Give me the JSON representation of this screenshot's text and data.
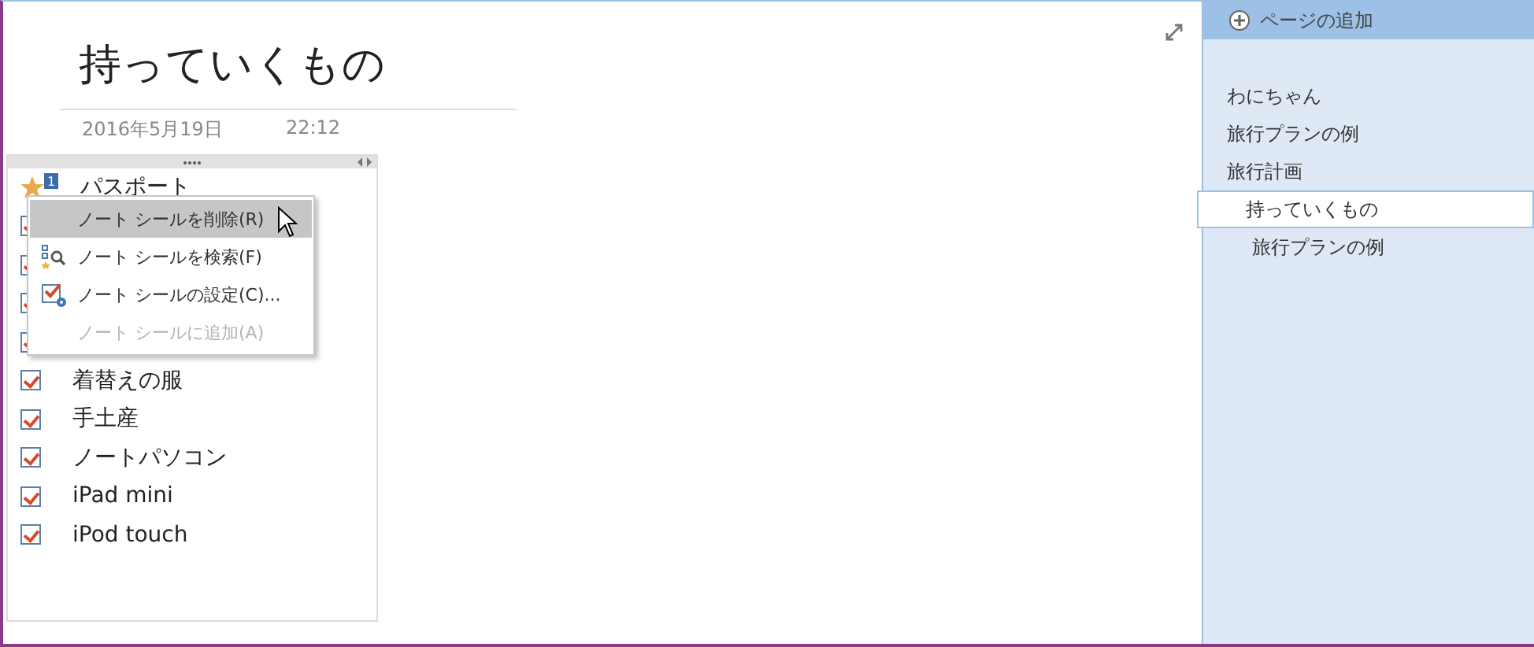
{
  "page": {
    "title": "持っていくもの",
    "date": "2016年5月19日",
    "time": "22:12"
  },
  "items": [
    {
      "kind": "tag",
      "tag_number": "1",
      "label": "パスポート"
    },
    {
      "kind": "checkbox",
      "checked": true
    },
    {
      "kind": "checkbox",
      "checked": true
    },
    {
      "kind": "checkbox",
      "checked": true
    },
    {
      "kind": "checkbox",
      "checked": true
    },
    {
      "kind": "checkbox",
      "checked": true,
      "label": "着替えの服"
    },
    {
      "kind": "checkbox",
      "checked": true,
      "label": "手土産"
    },
    {
      "kind": "checkbox",
      "checked": true,
      "label": "ノートパソコン"
    },
    {
      "kind": "checkbox",
      "checked": true,
      "label": "iPad mini"
    },
    {
      "kind": "checkbox",
      "checked": true,
      "label": "iPod touch"
    }
  ],
  "context_menu": [
    {
      "label": "ノート シールを削除(R)",
      "selected": true,
      "disabled": false
    },
    {
      "label": "ノート シールを検索(F)",
      "selected": false,
      "disabled": false
    },
    {
      "label": "ノート シールの設定(C)...",
      "selected": false,
      "disabled": false
    },
    {
      "label": "ノート シールに追加(A)",
      "selected": false,
      "disabled": true
    }
  ],
  "sidebar": {
    "add_page": "ページの追加",
    "pages": [
      {
        "label": "わにちゃん",
        "selected": false
      },
      {
        "label": "旅行プランの例",
        "selected": false
      },
      {
        "label": "旅行計画",
        "selected": false,
        "children": [
          {
            "label": "持っていくもの",
            "selected": true
          },
          {
            "label": "旅行プランの例",
            "selected": false
          }
        ]
      }
    ]
  }
}
